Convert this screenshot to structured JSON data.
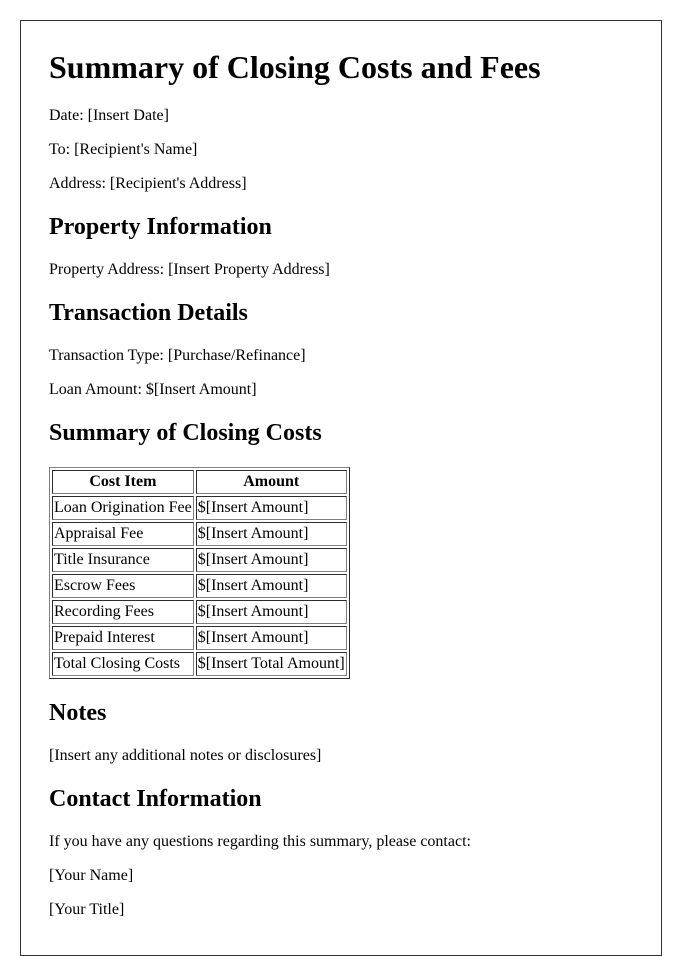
{
  "document": {
    "title": "Summary of Closing Costs and Fees",
    "date_line": "Date: [Insert Date]",
    "to_line": "To: [Recipient's Name]",
    "address_line": "Address: [Recipient's Address]"
  },
  "property": {
    "heading": "Property Information",
    "address_line": "Property Address: [Insert Property Address]"
  },
  "transaction": {
    "heading": "Transaction Details",
    "type_line": "Transaction Type: [Purchase/Refinance]",
    "loan_line": "Loan Amount: $[Insert Amount]"
  },
  "costs": {
    "heading": "Summary of Closing Costs",
    "columns": [
      "Cost Item",
      "Amount"
    ],
    "rows": [
      {
        "item": "Loan Origination Fee",
        "amount": "$[Insert Amount]"
      },
      {
        "item": "Appraisal Fee",
        "amount": "$[Insert Amount]"
      },
      {
        "item": "Title Insurance",
        "amount": "$[Insert Amount]"
      },
      {
        "item": "Escrow Fees",
        "amount": "$[Insert Amount]"
      },
      {
        "item": "Recording Fees",
        "amount": "$[Insert Amount]"
      },
      {
        "item": "Prepaid Interest",
        "amount": "$[Insert Amount]"
      },
      {
        "item": "Total Closing Costs",
        "amount": "$[Insert Total Amount]"
      }
    ]
  },
  "notes": {
    "heading": "Notes",
    "text": "[Insert any additional notes or disclosures]"
  },
  "contact": {
    "heading": "Contact Information",
    "intro": "If you have any questions regarding this summary, please contact:",
    "name": "[Your Name]",
    "title": "[Your Title]"
  }
}
